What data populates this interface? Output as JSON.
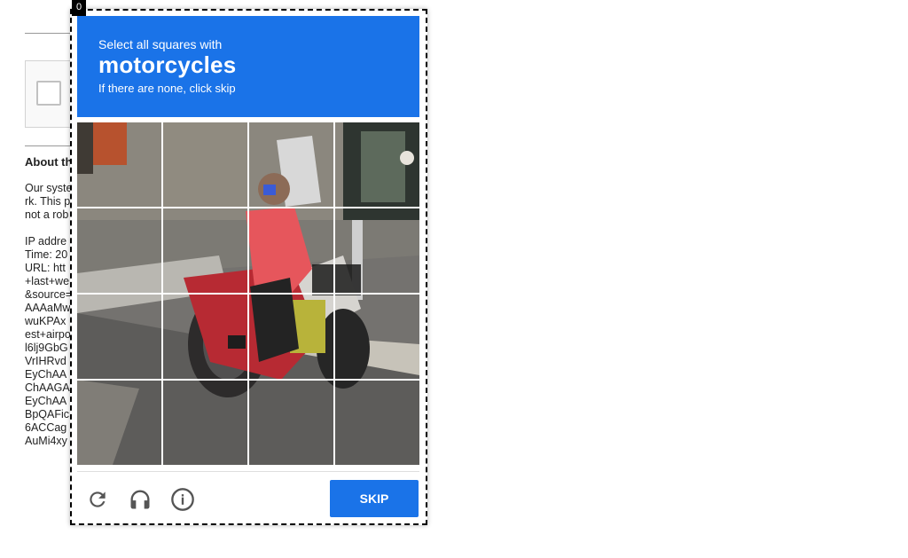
{
  "background_page": {
    "about_title": "About th",
    "lines_1": [
      "Our syste",
      "rk. This p",
      "not a rob"
    ],
    "lines_2": [
      "IP addre",
      "Time: 20",
      "URL: htt",
      "+last+we",
      "&source=",
      "AAAaMw",
      "wuKPAx",
      "est+airpo",
      "l6lj9GbG",
      "VrIHRvd",
      "EyChAA",
      "ChAAGA",
      "EyChAA",
      "BpQAFic",
      "6ACCag",
      "AuMi4xy"
    ]
  },
  "challenge": {
    "badge": "0",
    "header": {
      "instruction": "Select all squares with",
      "target": "motorcycles",
      "hint": "If there are none, click skip"
    },
    "grid": {
      "rows": 4,
      "cols": 4
    },
    "footer": {
      "reload_icon": "reload-icon",
      "audio_icon": "headphones-icon",
      "info_icon": "info-icon",
      "skip_label": "SKIP"
    },
    "colors": {
      "accent": "#1a73e8"
    }
  }
}
